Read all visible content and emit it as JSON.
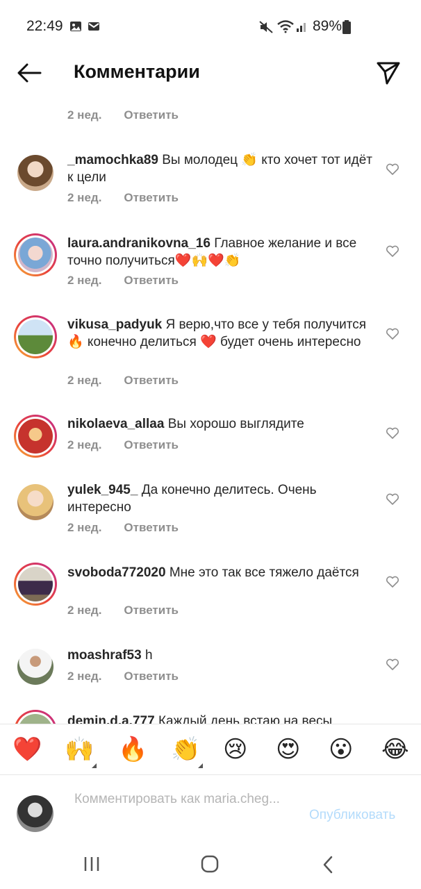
{
  "status_bar": {
    "time": "22:49",
    "battery": "89%"
  },
  "header": {
    "title": "Комментарии"
  },
  "top_meta": {
    "time": "2 нед.",
    "reply": "Ответить"
  },
  "comments": [
    {
      "username": "_mamochka89",
      "text": "Вы молодец 👏 кто хочет тот идёт к цели",
      "time": "2 нед.",
      "reply": "Ответить"
    },
    {
      "username": "laura.andranikovna_16",
      "text": "Главное желание и все точно получиться❤️🙌❤️👏",
      "time": "2 нед.",
      "reply": "Ответить"
    },
    {
      "username": "vikusa_padyuk",
      "text": "Я верю,что все у тебя получится 🔥 конечно делиться ❤️ будет очень интересно",
      "time": "2 нед.",
      "reply": "Ответить"
    },
    {
      "username": "nikolaeva_allaa",
      "text": "Вы хорошо выглядите",
      "time": "2 нед.",
      "reply": "Ответить"
    },
    {
      "username": "yulek_945_",
      "text": "Да конечно делитесь. Очень интересно",
      "time": "2 нед.",
      "reply": "Ответить"
    },
    {
      "username": "svoboda772020",
      "text": "Мне это так все тяжело даётся",
      "time": "2 нед.",
      "reply": "Ответить"
    },
    {
      "username": "moashraf53",
      "text": "h",
      "time": "2 нед.",
      "reply": "Ответить"
    },
    {
      "username": "demin.d.a.777",
      "text": "Каждый день встаю на весы"
    }
  ],
  "emoji_bar": [
    "❤️",
    "🙌",
    "🔥",
    "👏",
    "😢",
    "😍",
    "😮",
    "😂"
  ],
  "input": {
    "placeholder": "Комментировать как maria.cheg...",
    "publish_label": "Опубликовать"
  },
  "colors": {
    "link_disabled": "#b3dbfb",
    "muted": "#8e8e8e",
    "heart": "#ed4956"
  }
}
